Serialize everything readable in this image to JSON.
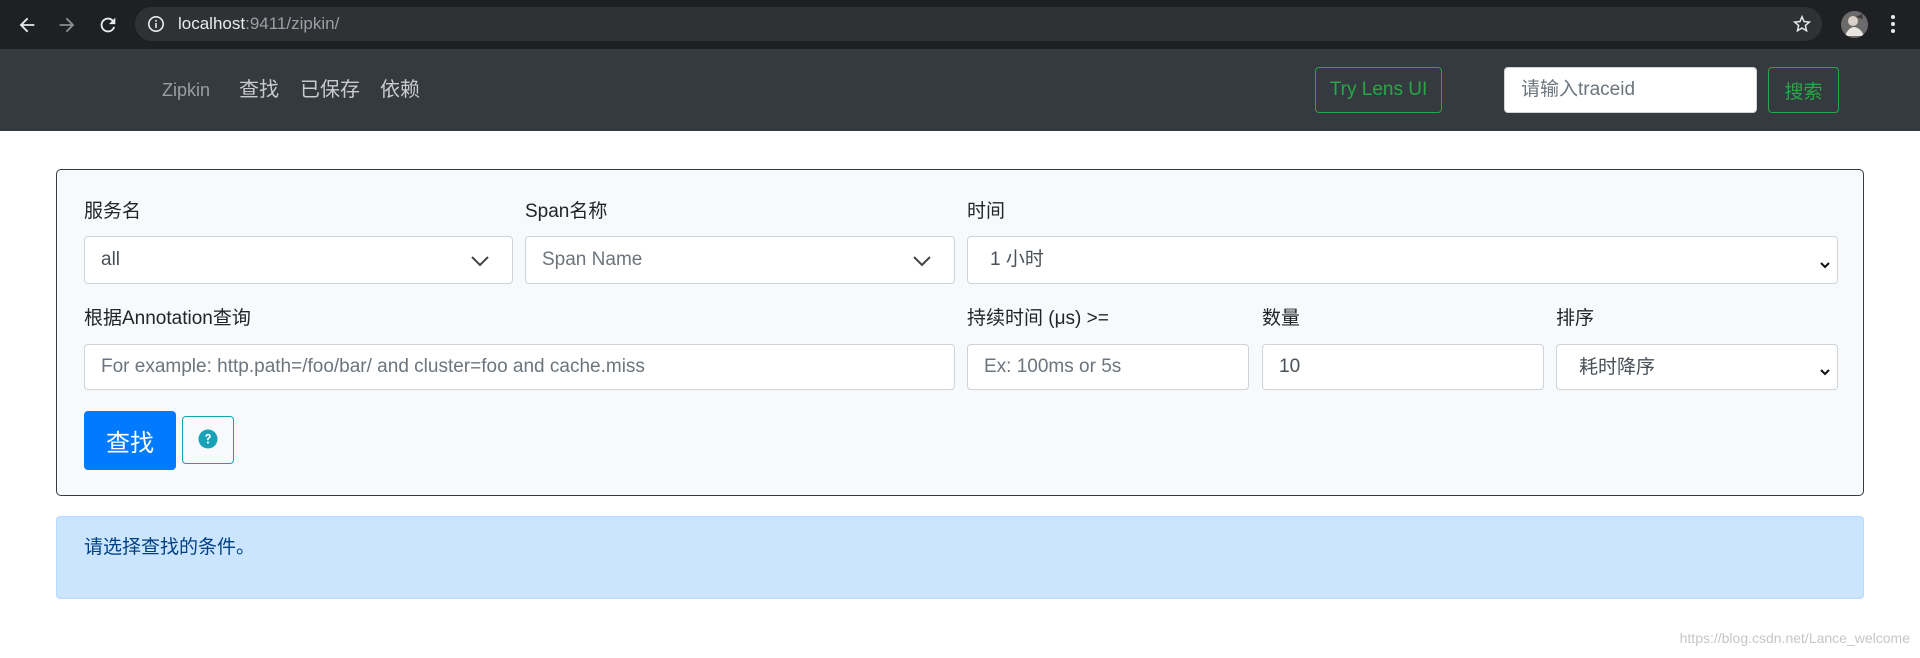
{
  "browser": {
    "url_host": "localhost",
    "url_path": ":9411/zipkin/",
    "icons": [
      "back-arrow-icon",
      "forward-arrow-icon",
      "reload-icon",
      "info-icon",
      "star-icon",
      "avatar",
      "menu-dots-icon"
    ]
  },
  "navbar": {
    "brand": "Zipkin",
    "links": [
      {
        "label": "查找"
      },
      {
        "label": "已保存"
      },
      {
        "label": "依赖"
      }
    ],
    "lens_button": "Try Lens UI",
    "traceid_placeholder": "请输入traceid",
    "search_button": "搜索"
  },
  "search_form": {
    "service": {
      "label": "服务名",
      "value": "all"
    },
    "span": {
      "label": "Span名称",
      "placeholder": "Span Name"
    },
    "time": {
      "label": "时间",
      "value": "1 小时"
    },
    "annotation": {
      "label": "根据Annotation查询",
      "placeholder": "For example: http.path=/foo/bar/ and cluster=foo and cache.miss"
    },
    "duration": {
      "label": "持续时间 (μs) >=",
      "placeholder": "Ex: 100ms or 5s"
    },
    "limit": {
      "label": "数量",
      "value": "10"
    },
    "sort": {
      "label": "排序",
      "value": "耗时降序"
    },
    "find_button": "查找",
    "help_icon": "question-circle-icon"
  },
  "alert": {
    "message": "请选择查找的条件。"
  },
  "watermark": "https://blog.csdn.net/Lance_welcome",
  "colors": {
    "navbar_bg": "#343a40",
    "success": "#28a745",
    "primary": "#007bff",
    "info": "#17a2b8",
    "panel_bg": "#f8f9fa",
    "alert_bg": "#cce5ff",
    "alert_text": "#004085"
  }
}
